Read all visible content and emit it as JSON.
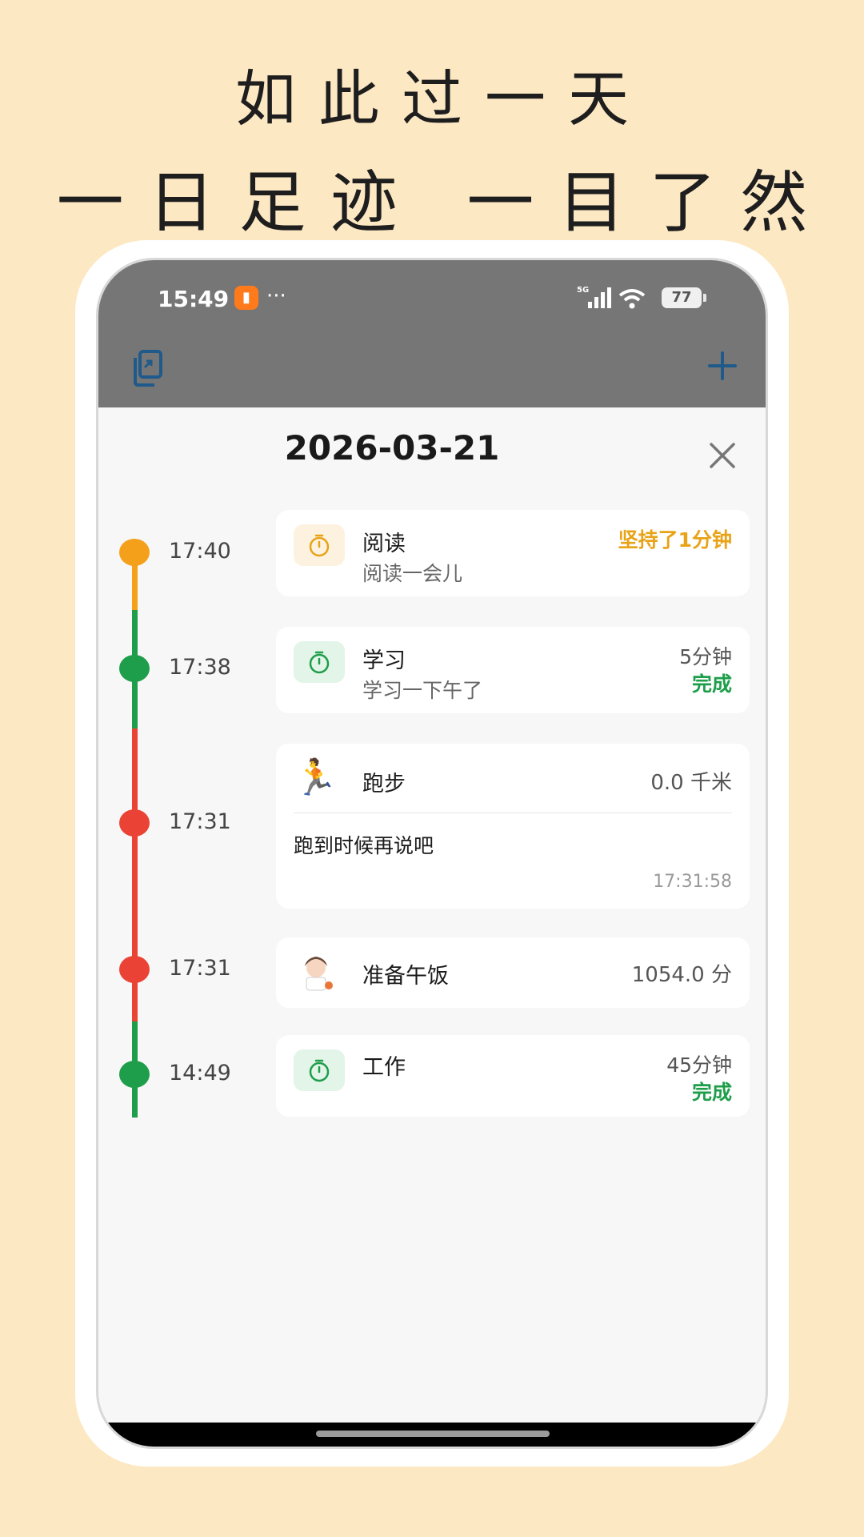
{
  "promo": {
    "line1": "如此过一天",
    "line2": "一日足迹 一目了然"
  },
  "status_bar": {
    "time": "15:49",
    "dots": "···",
    "network": "5G",
    "battery": "77"
  },
  "header": {
    "date": "2026-03-21"
  },
  "timeline": [
    {
      "time": "17:40",
      "color": "#f5a01b"
    },
    {
      "time": "17:38",
      "color": "#1e9e4a"
    },
    {
      "time": "17:31",
      "color": "#ea4335"
    },
    {
      "time": "17:31",
      "color": "#ea4335"
    },
    {
      "time": "14:49",
      "color": "#1e9e4a"
    }
  ],
  "cards": [
    {
      "icon": "timer-icon",
      "title": "阅读",
      "subtitle": "阅读一会儿",
      "right": "坚持了1分钟",
      "right_color": "#e8a317",
      "icon_bg": "#fdf2e0",
      "icon_color": "#e8a317"
    },
    {
      "icon": "timer-icon",
      "title": "学习",
      "subtitle": "学习一下午了",
      "duration": "5分钟",
      "status": "完成",
      "status_color": "#1e9e4a",
      "icon_bg": "#e3f4e8",
      "icon_color": "#1e9e4a"
    },
    {
      "icon": "runner-emoji-icon",
      "title": "跑步",
      "distance": "0.0 千米",
      "note": "跑到时候再说吧",
      "timestamp": "17:31:58"
    },
    {
      "icon": "cooking-girl-icon",
      "title": "准备午饭",
      "score": "1054.0 分"
    },
    {
      "icon": "timer-icon",
      "title": "工作",
      "duration": "45分钟",
      "status": "完成",
      "status_color": "#1e9e4a",
      "icon_bg": "#e3f4e8",
      "icon_color": "#1e9e4a"
    }
  ]
}
